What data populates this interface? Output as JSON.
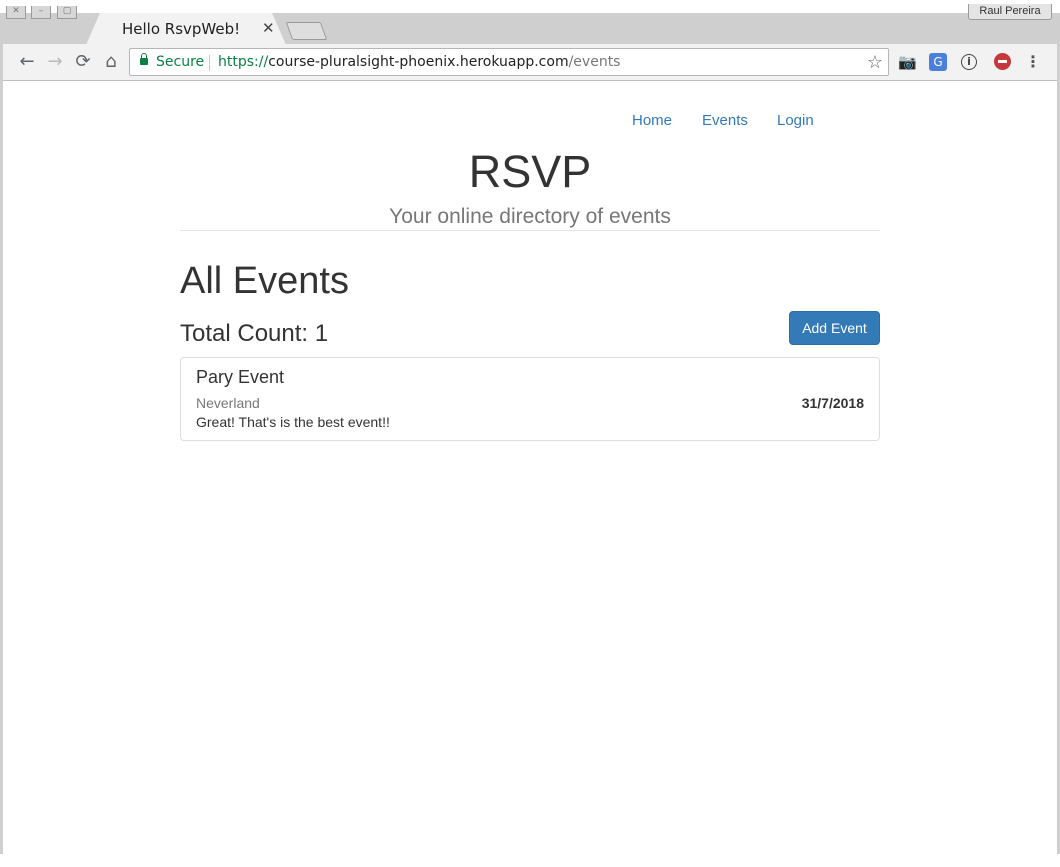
{
  "browser": {
    "window_buttons": [
      "✕",
      "–",
      "▢"
    ],
    "profile_name": "Raul Pereira",
    "tab": {
      "title": "Hello RsvpWeb!",
      "close_glyph": "✕"
    },
    "nav_icons": {
      "back": "←",
      "forward": "→",
      "reload": "⟳",
      "home": "⌂"
    },
    "omnibox": {
      "secure_label": "Secure",
      "url_scheme": "https://",
      "url_host": "course-pluralsight-phoenix.herokuapp.com",
      "url_path": "/events"
    },
    "extension_icons": [
      "camera-icon",
      "translate-icon",
      "info-icon",
      "adblock-icon",
      "menu-icon"
    ],
    "ext_glyphs": {
      "camera": "📷",
      "translate": "G",
      "info": "i",
      "menu": "⋮",
      "star": "☆"
    }
  },
  "nav": {
    "items": [
      {
        "label": "Home"
      },
      {
        "label": "Events"
      },
      {
        "label": "Login"
      }
    ]
  },
  "header": {
    "brand": "RSVP",
    "tagline": "Your online directory of events"
  },
  "main": {
    "heading": "All Events",
    "total_count": "Total Count: 1",
    "add_button": "Add Event",
    "events": [
      {
        "title": "Pary Event",
        "location": "Neverland",
        "description": "Great! That's is the best event!!",
        "date": "31/7/2018"
      }
    ]
  },
  "colors": {
    "link": "#337ab7",
    "primary_button": "#337ab7",
    "secure_green": "#0b8043",
    "text": "#333333",
    "muted": "#777777"
  }
}
